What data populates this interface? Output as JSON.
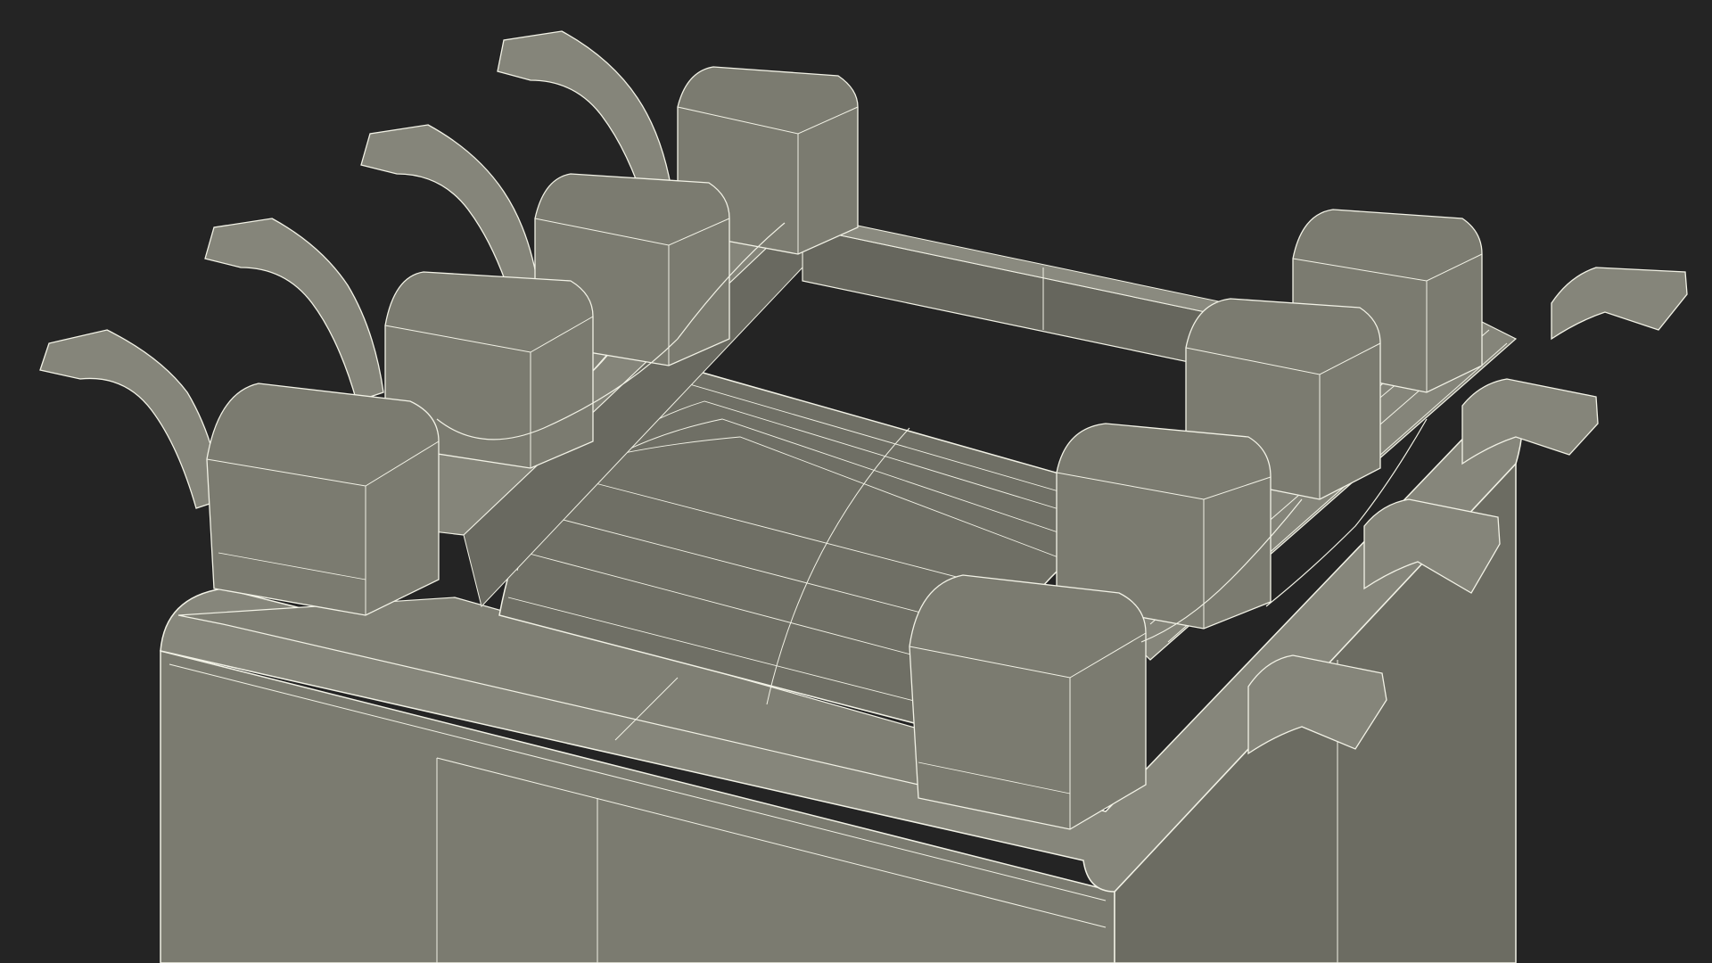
{
  "scene": {
    "subject": "transformer-3d-wireframe-model",
    "background_color": "#242424",
    "surface_color": "#7b7b70",
    "surface_shadow_color": "#5c5c53",
    "surface_dark_color": "#4a4a43",
    "wire_color": "#f2f2e6",
    "core_color": "#6f6f65",
    "pin_count_left": 4,
    "pin_count_right": 4,
    "terminal_block_count_left": 4,
    "terminal_block_count_right": 4
  }
}
